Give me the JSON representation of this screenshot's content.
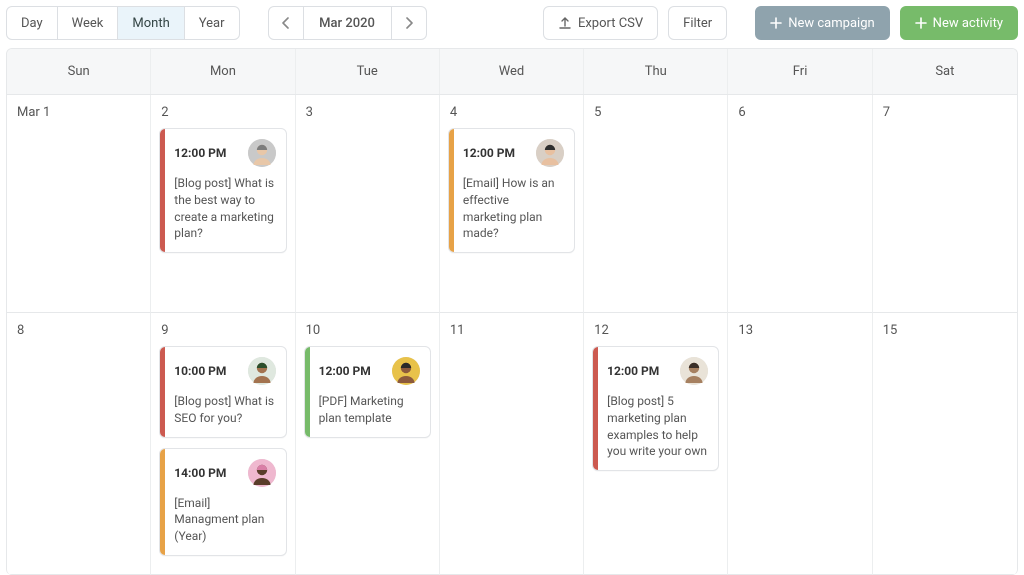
{
  "toolbar": {
    "views": [
      "Day",
      "Week",
      "Month",
      "Year"
    ],
    "active_view_index": 2,
    "period_label": "Mar 2020",
    "export_label": "Export CSV",
    "filter_label": "Filter",
    "new_campaign_label": "New campaign",
    "new_activity_label": "New activity"
  },
  "calendar": {
    "weekdays": [
      "Sun",
      "Mon",
      "Tue",
      "Wed",
      "Thu",
      "Fri",
      "Sat"
    ],
    "rows": [
      {
        "days": [
          {
            "label": "Mar 1",
            "events": []
          },
          {
            "label": "2",
            "events": [
              {
                "time": "12:00 PM",
                "title": "[Blog post] What is the best way to create a marketing plan?",
                "stripe": "c-red",
                "avatar": "a1"
              }
            ]
          },
          {
            "label": "3",
            "events": []
          },
          {
            "label": "4",
            "events": [
              {
                "time": "12:00 PM",
                "title": "[Email] How is an effective marketing plan made?",
                "stripe": "c-orange",
                "avatar": "a2"
              }
            ]
          },
          {
            "label": "5",
            "events": []
          },
          {
            "label": "6",
            "events": []
          },
          {
            "label": "7",
            "events": []
          }
        ]
      },
      {
        "days": [
          {
            "label": "8",
            "events": []
          },
          {
            "label": "9",
            "events": [
              {
                "time": "10:00 PM",
                "title": "[Blog post] What is SEO for you?",
                "stripe": "c-red",
                "avatar": "a3"
              },
              {
                "time": "14:00 PM",
                "title": "[Email] Managment plan (Year)",
                "stripe": "c-orange",
                "avatar": "a4"
              }
            ]
          },
          {
            "label": "10",
            "events": [
              {
                "time": "12:00 PM",
                "title": "[PDF] Marketing plan template",
                "stripe": "c-green",
                "avatar": "a5"
              }
            ]
          },
          {
            "label": "11",
            "events": []
          },
          {
            "label": "12",
            "events": [
              {
                "time": "12:00 PM",
                "title": "[Blog post] 5 marketing plan examples to help you write your own",
                "stripe": "c-red",
                "avatar": "a6"
              }
            ]
          },
          {
            "label": "13",
            "events": []
          },
          {
            "label": "15",
            "events": []
          }
        ]
      }
    ]
  },
  "avatars": {
    "a1": {
      "bg": "#c9c9c9",
      "skin": "#e8c7a8",
      "top": "#7d7d7d"
    },
    "a2": {
      "bg": "#d9cfc5",
      "skin": "#e8c0a0",
      "top": "#2f2f2f"
    },
    "a3": {
      "bg": "#dfe8df",
      "skin": "#a3734f",
      "top": "#2c4f2c"
    },
    "a4": {
      "bg": "#efb8cf",
      "skin": "#5a3d2a",
      "top": "#d97fa6"
    },
    "a5": {
      "bg": "#e8c24a",
      "skin": "#8c5a3c",
      "top": "#2a2a2a"
    },
    "a6": {
      "bg": "#e9e3d8",
      "skin": "#a68060",
      "top": "#3a2f28"
    }
  }
}
